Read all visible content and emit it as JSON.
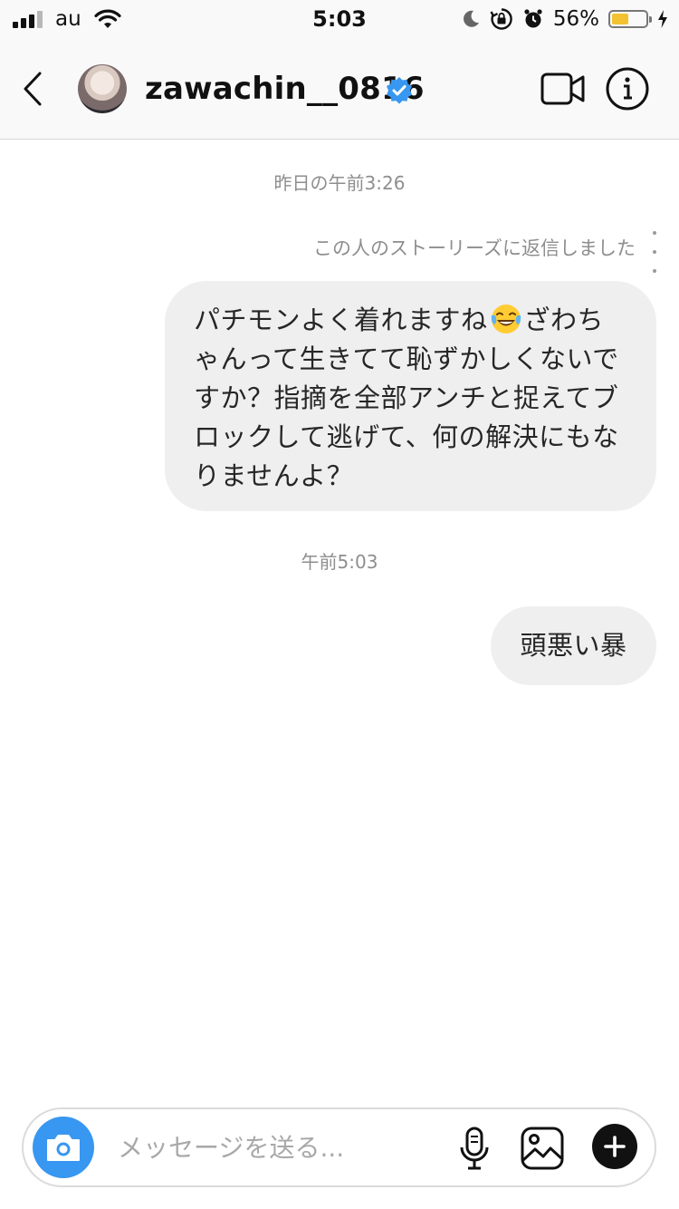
{
  "status_bar": {
    "carrier": "au",
    "time": "5:03",
    "battery_percent": "56%",
    "battery_level": 0.56,
    "battery_color": "#f2c230"
  },
  "header": {
    "back_icon": "chevron-left-icon",
    "username": "zawachin__0816",
    "verified": true,
    "verified_color": "#3897f0",
    "video_call_icon": "video-camera-icon",
    "info_icon": "info-icon"
  },
  "thread": {
    "timestamp_1": "昨日の午前3:26",
    "story_reply_note": "この人のストーリーズに返信しました",
    "message_1": {
      "part_1": "パチモンよく着れますね",
      "emoji": "face-with-tears-of-joy-icon",
      "part_2": "ざわちゃんって生きてて恥ずかしくないですか？指摘を全部アンチと捉えてブロックして逃げて、何の解決にもなりませんよ？"
    },
    "timestamp_2": "午前5:03",
    "message_2": "頭悪い暴",
    "bubble_color": "#efefef"
  },
  "composer": {
    "placeholder": "メッセージを送る...",
    "camera_icon": "camera-icon",
    "mic_icon": "microphone-icon",
    "gallery_icon": "image-icon",
    "plus_icon": "plus-icon",
    "accent_color": "#3897f0"
  }
}
